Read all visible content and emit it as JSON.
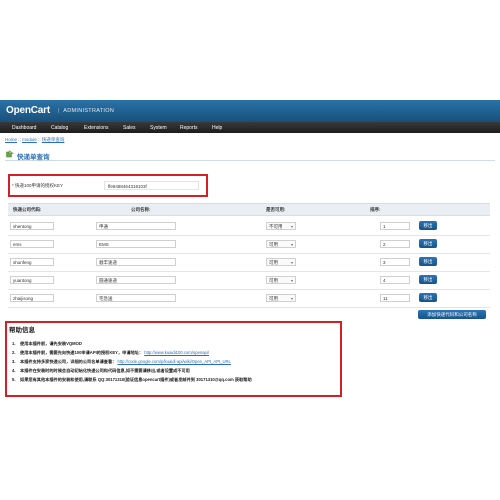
{
  "header": {
    "logo": "OpenCart",
    "separator": "|",
    "subtitle": "ADMINISTRATION"
  },
  "menu": [
    "Dashboard",
    "Catalog",
    "Extensions",
    "Sales",
    "System",
    "Reports",
    "Help"
  ],
  "breadcrumb": {
    "items": [
      "Home",
      "module",
      "快递单查询"
    ],
    "separator": "::"
  },
  "page": {
    "title": "快递单查询"
  },
  "api_key": {
    "required_mark": "*",
    "label": "快递100申请的授权KEY",
    "value": "ffe8488464318103f"
  },
  "table": {
    "columns": [
      "快递公司代码:",
      "公司名称:",
      "是否可用:",
      "排序:"
    ],
    "rows": [
      {
        "code": "shentong",
        "name": "申通",
        "status": "不可用",
        "order": "1",
        "action": "移出"
      },
      {
        "code": "ems",
        "name": "EMS",
        "status": "可用",
        "order": "2",
        "action": "移出"
      },
      {
        "code": "shunfeng",
        "name": "顺丰速递",
        "status": "可用",
        "order": "3",
        "action": "移出"
      },
      {
        "code": "yuantong",
        "name": "圆通速递",
        "status": "可用",
        "order": "4",
        "action": "移出"
      },
      {
        "code": "zhaijisong",
        "name": "宅急送",
        "status": "可用",
        "order": "11",
        "action": "移出"
      }
    ],
    "add_button": "添加快递代码和公司名称"
  },
  "help": {
    "title": "帮助信息",
    "items": [
      {
        "num": "1.",
        "text": "使用本插件前，请先安装VQMOD",
        "url": ""
      },
      {
        "num": "2.",
        "text": "使用本插件前，需要先向快递100申请API的授权KEY，申请地址：",
        "url": "http://www.kuaidi100.com/openapi/"
      },
      {
        "num": "3.",
        "text": "本插件支持多家快递公司，详细的公司名单请查看：",
        "url": "http://code.google.com/p/kuaidi-api/wiki/Open_API_API_URL"
      },
      {
        "num": "4.",
        "text": "本插件在安装时的时候会自动初始化快递公司和代码信息,如不需要请移出,或者设置成不可用",
        "url": ""
      },
      {
        "num": "5.",
        "text": "如果您有其他本插件的安装和使用,请联系 QQ:30171310(验证信息opencart插件)或者发邮件到 30171310@qq.com 获取帮助",
        "url": ""
      }
    ]
  },
  "colors": {
    "header_blue": "#1f5c8a",
    "menu_dark": "#262626",
    "link_blue": "#2a6ebb",
    "highlight_red": "#d32027",
    "button_blue": "#1d5f9e"
  }
}
